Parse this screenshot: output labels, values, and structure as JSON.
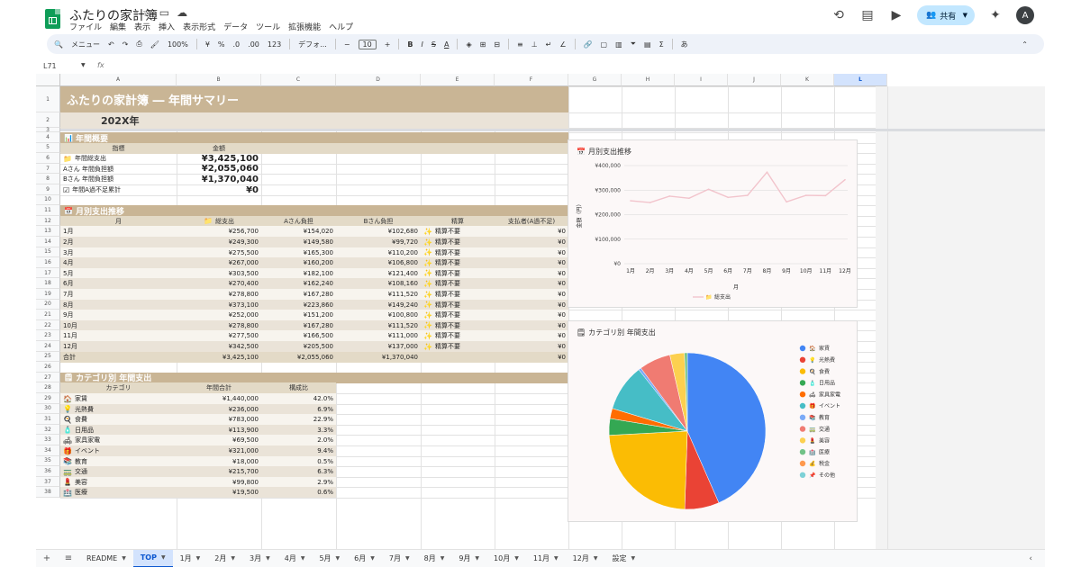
{
  "app": {
    "doc_title": "ふたりの家計簿",
    "menu": [
      "ファイル",
      "編集",
      "表示",
      "挿入",
      "表示形式",
      "データ",
      "ツール",
      "拡張機能",
      "ヘルプ"
    ],
    "share_label": "共有",
    "avatar_initial": "A"
  },
  "toolbar": {
    "search_label": "メニュー",
    "zoom": "100%",
    "pct": "%",
    "decimal_dec": ".0",
    "decimal_inc": ".00",
    "num_fmt": "123",
    "font_family": "デフォ...",
    "font_size": "10",
    "input_tool": "あ"
  },
  "formula_bar": {
    "cell_ref": "L71",
    "fx": "fx",
    "value": ""
  },
  "grid": {
    "columns": [
      "A",
      "B",
      "C",
      "D",
      "E",
      "F",
      "G",
      "H",
      "I",
      "J",
      "K",
      "L"
    ],
    "active_column": "L",
    "rows": [
      "1",
      "2",
      "3",
      "4",
      "5",
      "6",
      "7",
      "8",
      "9",
      "10",
      "11",
      "12",
      "13",
      "14",
      "15",
      "16",
      "17",
      "18",
      "19",
      "20",
      "21",
      "22",
      "23",
      "24",
      "25",
      "26",
      "27",
      "28",
      "29",
      "30",
      "31",
      "32",
      "33",
      "34",
      "35",
      "36",
      "37",
      "38"
    ]
  },
  "sheet": {
    "title": "ふたりの家計簿 ― 年間サマリー",
    "year": "202X年",
    "overview": {
      "section_title": "年間概要",
      "headers": [
        "指標",
        "金額"
      ],
      "rows": [
        {
          "label": "年間総支出",
          "value": "¥3,425,100"
        },
        {
          "label": "Aさん 年間負担額",
          "value": "¥2,055,060"
        },
        {
          "label": "Bさん 年間負担額",
          "value": "¥1,370,040"
        },
        {
          "label": "年間A過不足累計",
          "value": "¥0"
        }
      ]
    },
    "monthly": {
      "section_title": "月別支出推移",
      "headers": [
        "月",
        "総支出",
        "Aさん負担",
        "Bさん負担",
        "精算",
        "支払者(A過不足)"
      ],
      "rows": [
        {
          "month": "1月",
          "total": "¥256,700",
          "a": "¥154,020",
          "b": "¥102,680",
          "settle": "精算不要",
          "diff": "¥0"
        },
        {
          "month": "2月",
          "total": "¥249,300",
          "a": "¥149,580",
          "b": "¥99,720",
          "settle": "精算不要",
          "diff": "¥0"
        },
        {
          "month": "3月",
          "total": "¥275,500",
          "a": "¥165,300",
          "b": "¥110,200",
          "settle": "精算不要",
          "diff": "¥0"
        },
        {
          "month": "4月",
          "total": "¥267,000",
          "a": "¥160,200",
          "b": "¥106,800",
          "settle": "精算不要",
          "diff": "¥0"
        },
        {
          "month": "5月",
          "total": "¥303,500",
          "a": "¥182,100",
          "b": "¥121,400",
          "settle": "精算不要",
          "diff": "¥0"
        },
        {
          "month": "6月",
          "total": "¥270,400",
          "a": "¥162,240",
          "b": "¥108,160",
          "settle": "精算不要",
          "diff": "¥0"
        },
        {
          "month": "7月",
          "total": "¥278,800",
          "a": "¥167,280",
          "b": "¥111,520",
          "settle": "精算不要",
          "diff": "¥0"
        },
        {
          "month": "8月",
          "total": "¥373,100",
          "a": "¥223,860",
          "b": "¥149,240",
          "settle": "精算不要",
          "diff": "¥0"
        },
        {
          "month": "9月",
          "total": "¥252,000",
          "a": "¥151,200",
          "b": "¥100,800",
          "settle": "精算不要",
          "diff": "¥0"
        },
        {
          "month": "10月",
          "total": "¥278,800",
          "a": "¥167,280",
          "b": "¥111,520",
          "settle": "精算不要",
          "diff": "¥0"
        },
        {
          "month": "11月",
          "total": "¥277,500",
          "a": "¥166,500",
          "b": "¥111,000",
          "settle": "精算不要",
          "diff": "¥0"
        },
        {
          "month": "12月",
          "total": "¥342,500",
          "a": "¥205,500",
          "b": "¥137,000",
          "settle": "精算不要",
          "diff": "¥0"
        }
      ],
      "total_row": {
        "month": "合計",
        "total": "¥3,425,100",
        "a": "¥2,055,060",
        "b": "¥1,370,040",
        "settle": "",
        "diff": "¥0"
      }
    },
    "category": {
      "section_title": "カテゴリ別 年間支出",
      "headers": [
        "カテゴリ",
        "年間合計",
        "構成比"
      ],
      "rows": [
        {
          "icon": "🏠",
          "name": "家賃",
          "total": "¥1,440,000",
          "ratio": "42.0%"
        },
        {
          "icon": "💡",
          "name": "光熱費",
          "total": "¥236,000",
          "ratio": "6.9%"
        },
        {
          "icon": "🍳",
          "name": "食費",
          "total": "¥783,000",
          "ratio": "22.9%"
        },
        {
          "icon": "🧴",
          "name": "日用品",
          "total": "¥113,900",
          "ratio": "3.3%"
        },
        {
          "icon": "🛋",
          "name": "家具家電",
          "total": "¥69,500",
          "ratio": "2.0%"
        },
        {
          "icon": "🎁",
          "name": "イベント",
          "total": "¥321,000",
          "ratio": "9.4%"
        },
        {
          "icon": "📚",
          "name": "教育",
          "total": "¥18,000",
          "ratio": "0.5%"
        },
        {
          "icon": "🚃",
          "name": "交通",
          "total": "¥215,700",
          "ratio": "6.3%"
        },
        {
          "icon": "💄",
          "name": "美容",
          "total": "¥99,800",
          "ratio": "2.9%"
        },
        {
          "icon": "🏥",
          "name": "医療",
          "total": "¥19,500",
          "ratio": "0.6%"
        }
      ]
    }
  },
  "chart_data": [
    {
      "type": "line",
      "title": "月別支出推移",
      "x": [
        "1月",
        "2月",
        "3月",
        "4月",
        "5月",
        "6月",
        "7月",
        "8月",
        "9月",
        "10月",
        "11月",
        "12月"
      ],
      "series": [
        {
          "name": "総支出",
          "values": [
            256700,
            249300,
            275500,
            267000,
            303500,
            270400,
            278800,
            373100,
            252000,
            278800,
            277500,
            342500
          ],
          "color": "#f2c4cc"
        }
      ],
      "xlabel": "月",
      "ylabel": "金額（円）",
      "ylim": [
        0,
        400000
      ],
      "yticks": [
        "¥0",
        "¥100,000",
        "¥200,000",
        "¥300,000",
        "¥400,000"
      ],
      "grid": true,
      "legend": "bottom"
    },
    {
      "type": "pie",
      "title": "カテゴリ別 年間支出",
      "categories": [
        "家賃",
        "光熱費",
        "食費",
        "日用品",
        "家具家電",
        "イベント",
        "教育",
        "交通",
        "美容",
        "医療",
        "税金",
        "その他"
      ],
      "legend_icons": [
        "🏠",
        "💡",
        "🍳",
        "🧴",
        "🛋",
        "🎁",
        "📚",
        "🚃",
        "💄",
        "🏥",
        "💰",
        "📌"
      ],
      "values": [
        1440000,
        236000,
        783000,
        113900,
        69500,
        321000,
        18000,
        215700,
        99800,
        19500,
        0,
        0
      ],
      "colors": [
        "#4285f4",
        "#ea4335",
        "#fbbc04",
        "#34a853",
        "#ff6d01",
        "#46bdc6",
        "#7baaf7",
        "#f07b72",
        "#fcd04f",
        "#71c287",
        "#ff994d",
        "#7ed1d7"
      ],
      "legend": "right"
    }
  ],
  "tabs": [
    "README",
    "TOP",
    "1月",
    "2月",
    "3月",
    "4月",
    "5月",
    "6月",
    "7月",
    "8月",
    "9月",
    "10月",
    "11月",
    "12月",
    "設定"
  ],
  "active_tab": "TOP"
}
